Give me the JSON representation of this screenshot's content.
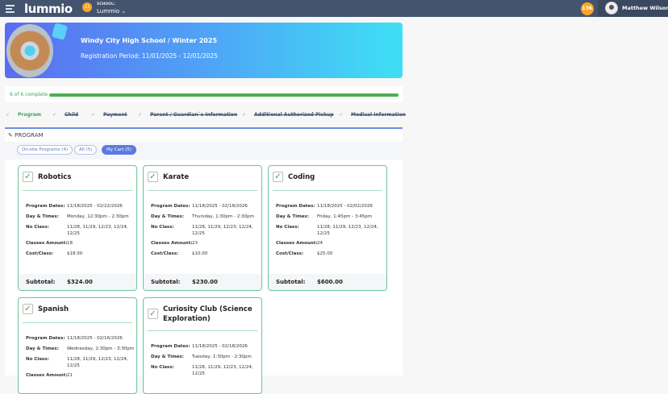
{
  "header": {
    "logo": "lummio",
    "notification_count": "13",
    "school_label": "SCHOOL:",
    "school_value": "Lummio ⌄",
    "coins": "13K",
    "user_name": "Matthew Wilson ⌄"
  },
  "banner": {
    "title": "Windy City High School / Winter 2025",
    "period": "Registration Period: 11/01/2025 - 12/01/2025"
  },
  "progress": {
    "text": "6 of 6 complete",
    "percent": 100,
    "color": "#4caf50"
  },
  "steps": [
    {
      "label": "Program"
    },
    {
      "label": "Child"
    },
    {
      "label": "Payment"
    },
    {
      "label": "Parent / Guardian`s Information"
    },
    {
      "label": "Additional Authorized Pickup"
    },
    {
      "label": "Medical Information"
    }
  ],
  "program": {
    "title": "PROGRAM",
    "filters": [
      {
        "label": "On-site Programs (4)"
      },
      {
        "label": "All (5)"
      },
      {
        "label": "My Cart (5)",
        "active": true
      }
    ],
    "labels": {
      "dates": "Program Dates:",
      "times": "Day & Times:",
      "noclass": "No Class:",
      "amount": "Classes Amount:",
      "cost": "Cost/Class:",
      "subtotal": "Subtotal:"
    },
    "cards": [
      {
        "name": "Robotics",
        "dates": "11/18/2025 - 02/22/2026",
        "times": "Monday, 12:30pm - 2:30pm",
        "noclass": "11/28, 11/29, 12/23, 12/24, 12/25",
        "amount": "18",
        "cost": "$18.00",
        "subtotal": "$324.00"
      },
      {
        "name": "Karate",
        "dates": "11/18/2025 - 02/18/2026",
        "times": "Thursday, 1:30pm - 2:30pm",
        "noclass": "11/28, 11/29, 12/23, 12/24, 12/25",
        "amount": "23",
        "cost": "$10.00",
        "subtotal": "$230.00"
      },
      {
        "name": "Coding",
        "dates": "11/18/2025 - 02/02/2026",
        "times": "Friday, 1:45pm - 3:45pm",
        "noclass": "11/28, 11/29, 12/23, 12/24, 12/25",
        "amount": "24",
        "cost": "$25.00",
        "subtotal": "$600.00"
      },
      {
        "name": "Spanish",
        "dates": "11/18/2025 - 02/16/2026",
        "times": "Wednesday, 2:30pm - 3:30pm",
        "noclass": "11/28, 11/29, 12/23, 12/24, 12/25",
        "amount": "21"
      },
      {
        "name": "Curiosity Club (Science Exploration)",
        "dates": "11/18/2025 - 02/18/2026",
        "times": "Tuesday, 1:30pm - 2:30pm",
        "noclass": "11/28, 11/29, 12/23, 12/24, 12/25"
      }
    ]
  }
}
